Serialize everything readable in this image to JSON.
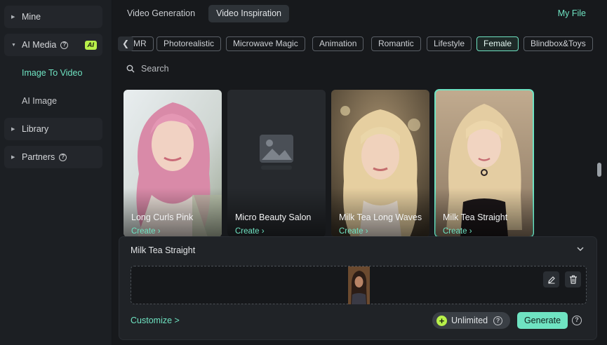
{
  "sidebar": {
    "mine": "Mine",
    "ai_media": "AI Media",
    "ai_badge": "AI",
    "help_glyph": "?",
    "image_to_video": "Image To Video",
    "ai_image": "AI Image",
    "library": "Library",
    "partners": "Partners"
  },
  "tabs": [
    {
      "label": "Video Generation"
    },
    {
      "label": "Video Inspiration"
    }
  ],
  "my_file": "My File",
  "chips": [
    "MR",
    "Photorealistic",
    "Microwave Magic",
    "Animation",
    "Romantic",
    "Lifestyle",
    "Female",
    "Blindbox&Toys"
  ],
  "active_chip": "Female",
  "search": {
    "placeholder": "Search"
  },
  "cards": [
    {
      "title": "Long Curls Pink",
      "create": "Create"
    },
    {
      "title": "Micro Beauty Salon",
      "create": "Create"
    },
    {
      "title": "Milk Tea Long Waves",
      "create": "Create"
    },
    {
      "title": "Milk Tea Straight",
      "create": "Create"
    }
  ],
  "panel": {
    "title": "Milk Tea Straight",
    "customize": "Customize >",
    "unlimited": "Unlimited",
    "generate": "Generate"
  },
  "colors": {
    "accent": "#6fe3c2",
    "badge": "#b8f04a"
  }
}
